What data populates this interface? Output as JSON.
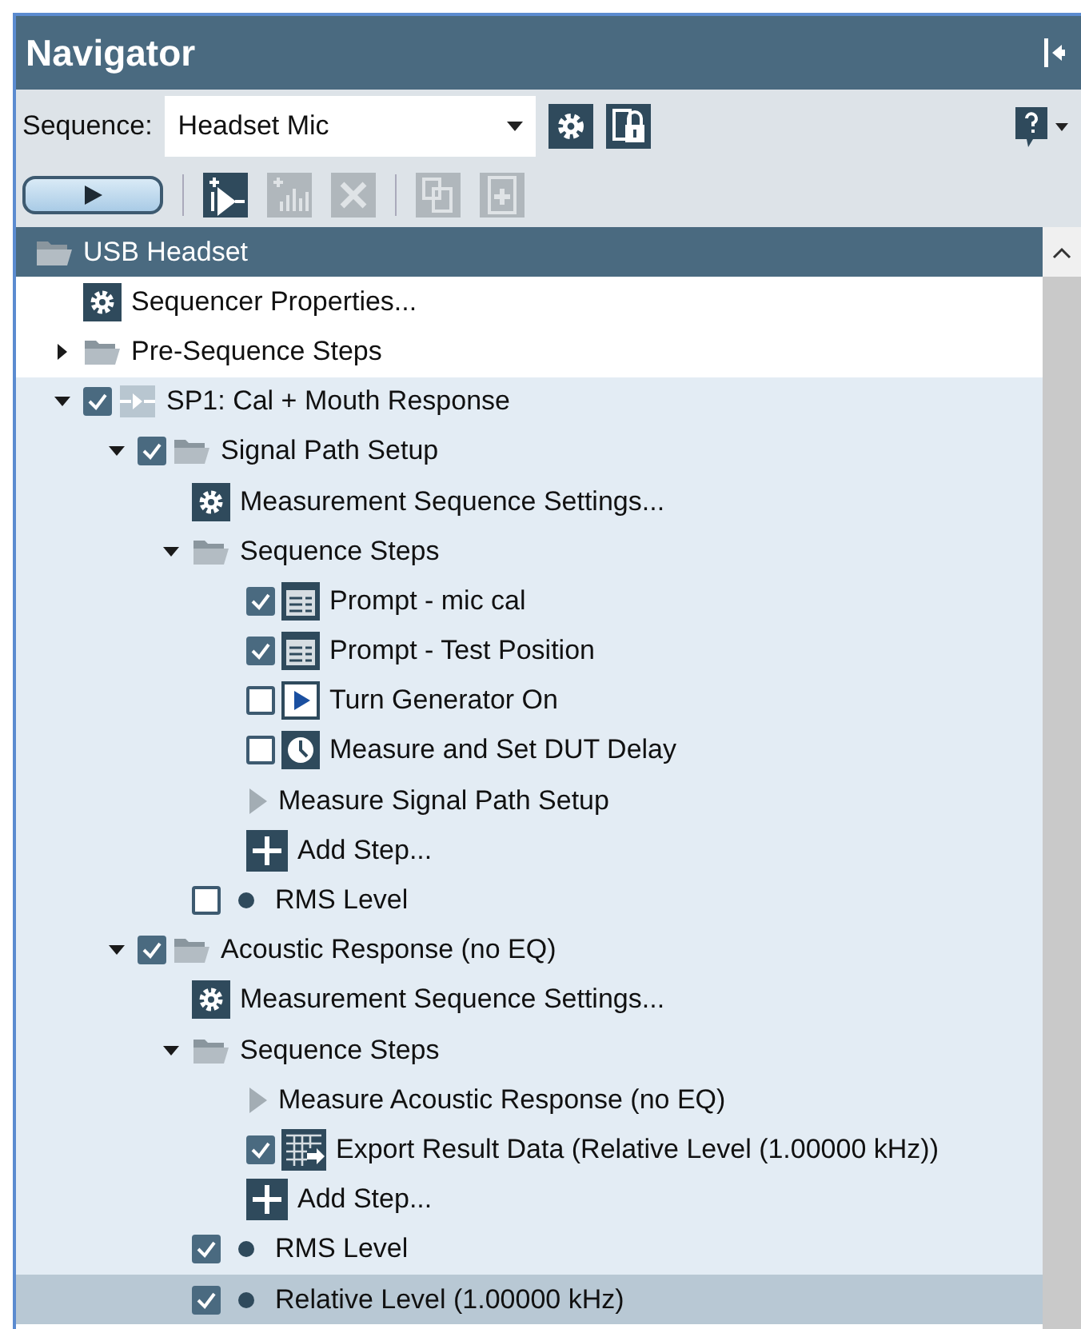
{
  "panel": {
    "title": "Navigator"
  },
  "sequence": {
    "label": "Sequence:",
    "value": "Headset Mic"
  },
  "toolbar": [
    {
      "kind": "play"
    },
    {
      "kind": "separator"
    },
    {
      "kind": "add-step",
      "disabled": false
    },
    {
      "kind": "add-meter",
      "disabled": true
    },
    {
      "kind": "delete",
      "disabled": true
    },
    {
      "kind": "separator"
    },
    {
      "kind": "copy",
      "disabled": true
    },
    {
      "kind": "add-page",
      "disabled": true
    }
  ],
  "tree": [
    {
      "label": "USB Headset",
      "kind": "folder",
      "selected": true,
      "children": [
        {
          "label": "Sequencer Properties...",
          "kind": "gear",
          "selected": false,
          "active": false
        },
        {
          "label": "Pre-Sequence Steps",
          "kind": "folder",
          "selected": false,
          "active": false,
          "expanded": false
        },
        {
          "label": "SP1: Cal + Mouth Response",
          "kind": "signalpath",
          "selected": false,
          "active": true,
          "expanded": true,
          "checked": true,
          "children": [
            {
              "label": "Signal Path Setup",
              "kind": "folder",
              "selected": false,
              "expanded": true,
              "checked": true,
              "children": [
                {
                  "label": "Measurement Sequence Settings...",
                  "kind": "gear",
                  "selected": false
                },
                {
                  "label": "Sequence Steps",
                  "kind": "folder",
                  "selected": false,
                  "expanded": true,
                  "children": [
                    {
                      "label": "Prompt - mic cal",
                      "kind": "prompt",
                      "selected": false,
                      "checked": true
                    },
                    {
                      "label": "Prompt - Test Position",
                      "kind": "prompt",
                      "selected": false,
                      "checked": true
                    },
                    {
                      "label": "Turn Generator On",
                      "kind": "generator",
                      "selected": false,
                      "checked": false
                    },
                    {
                      "label": "Measure and Set DUT Delay",
                      "kind": "clock",
                      "selected": false,
                      "checked": false
                    },
                    {
                      "label": "Measure Signal Path Setup",
                      "kind": "measure",
                      "selected": false
                    },
                    {
                      "label": "Add Step...",
                      "kind": "add",
                      "selected": false
                    }
                  ]
                },
                {
                  "label": "RMS Level",
                  "kind": "dot",
                  "selected": false,
                  "checked": false
                }
              ]
            },
            {
              "label": "Acoustic Response (no EQ)",
              "kind": "folder",
              "selected": false,
              "expanded": true,
              "checked": true,
              "children": [
                {
                  "label": "Measurement Sequence Settings...",
                  "kind": "gear",
                  "selected": false
                },
                {
                  "label": "Sequence Steps",
                  "kind": "folder",
                  "selected": false,
                  "expanded": true,
                  "children": [
                    {
                      "label": "Measure Acoustic Response (no EQ)",
                      "kind": "measure",
                      "selected": false
                    },
                    {
                      "label": "Export Result Data (Relative Level (1.00000 kHz))",
                      "kind": "export",
                      "selected": false,
                      "checked": true
                    },
                    {
                      "label": "Add Step...",
                      "kind": "add",
                      "selected": false
                    }
                  ]
                },
                {
                  "label": "RMS Level",
                  "kind": "dot",
                  "selected": false,
                  "checked": true
                },
                {
                  "label": "Relative Level (1.00000 kHz)",
                  "kind": "dot",
                  "selected": true,
                  "checked": true
                }
              ]
            }
          ]
        }
      ]
    }
  ]
}
